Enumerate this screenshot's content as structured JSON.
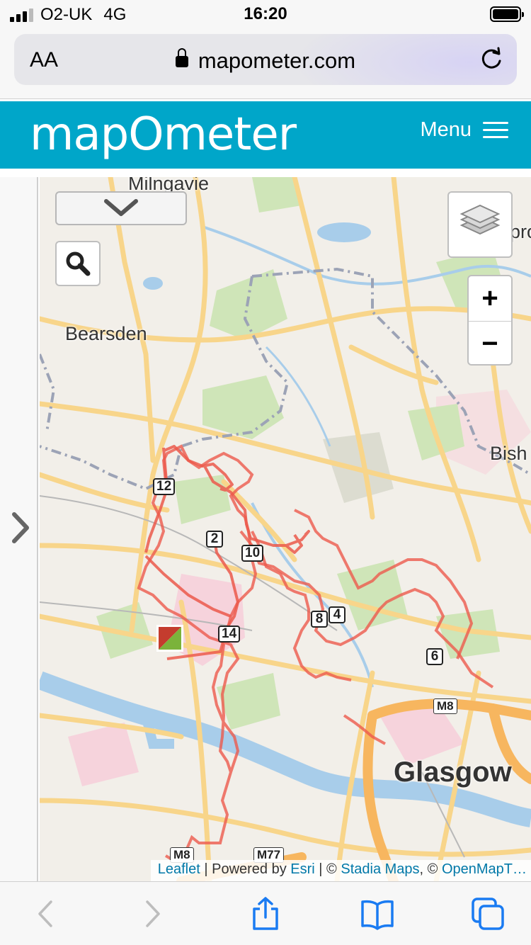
{
  "status_bar": {
    "carrier": "O2-UK",
    "network": "4G",
    "time": "16:20"
  },
  "browser": {
    "text_size_label": "AA",
    "url": "mapometer.com"
  },
  "site": {
    "logo": "mapOmeter",
    "menu_label": "Menu"
  },
  "map": {
    "places": [
      "Milngavie",
      "Bearsden",
      "Bish",
      "Glasgow",
      "pro"
    ],
    "route_markers": [
      "2",
      "4",
      "6",
      "8",
      "10",
      "12",
      "14"
    ],
    "road_labels": [
      "M8",
      "M8",
      "M77"
    ],
    "zoom_in_label": "+",
    "zoom_out_label": "−",
    "route_color": "#e8534a"
  },
  "attribution": {
    "leaflet": "Leaflet",
    "sep1": " | Powered by ",
    "esri": "Esri",
    "sep2": " | © ",
    "stadia": "Stadia Maps",
    "sep3": ", © ",
    "osm": "OpenMapT…"
  },
  "icons": [
    "chevron-down-icon",
    "search-icon",
    "layers-icon",
    "chevron-right-icon",
    "back-icon",
    "forward-icon",
    "share-icon",
    "bookmarks-icon",
    "tabs-icon",
    "reload-icon",
    "lock-icon"
  ]
}
